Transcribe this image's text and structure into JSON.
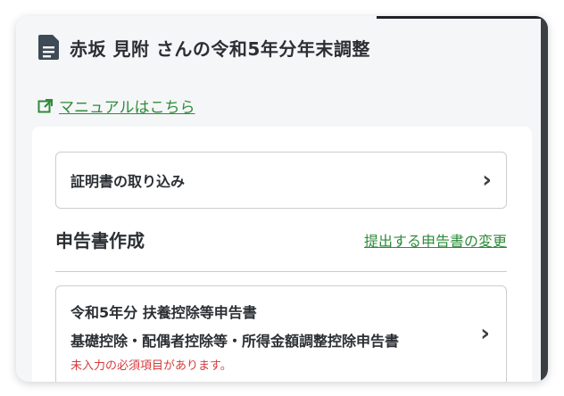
{
  "header": {
    "title": "赤坂 見附 さんの令和5年分年末調整",
    "title_icon": "document-icon"
  },
  "manual_link": {
    "label": "マニュアルはこちら",
    "icon": "external-link-icon"
  },
  "import_section": {
    "label": "証明書の取り込み"
  },
  "declaration_section": {
    "title": "申告書作成",
    "change_link": "提出する申告書の変更",
    "items": [
      {
        "line1": "令和5年分 扶養控除等申告書",
        "line2": "基礎控除・配偶者控除等・所得金額調整控除申告書",
        "warning": "未入力の必須項目があります。"
      }
    ]
  },
  "colors": {
    "link_green": "#2e8b3a",
    "warning_red": "#d63b3b",
    "text_dark": "#2b2f33",
    "page_bg": "#f5f6f8"
  }
}
